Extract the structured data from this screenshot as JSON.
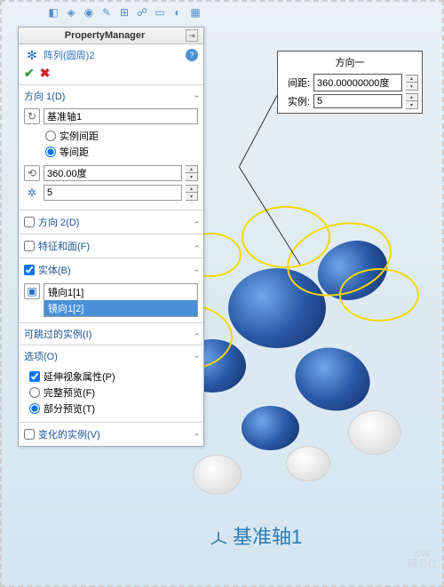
{
  "panel": {
    "title": "PropertyManager",
    "feature_name": "阵列(圆周)2",
    "sections": {
      "direction1": {
        "title": "方向 1(D)",
        "axis_value": "基准轴1",
        "radio_instance": "实例间距",
        "radio_equal": "等间距",
        "angle_value": "360.00度",
        "count_value": "5"
      },
      "direction2": {
        "title": "方向 2(D)"
      },
      "features_faces": {
        "title": "特征和面(F)"
      },
      "bodies": {
        "title": "实体(B)",
        "items": [
          "镜向1[1]",
          "镜向1[2]"
        ]
      },
      "skip_instances": {
        "title": "可跳过的实例(I)"
      },
      "options": {
        "title": "选项(O)",
        "extend_visual": "延伸视象属性(P)",
        "full_preview": "完整预览(F)",
        "partial_preview": "部分预览(T)"
      },
      "varied_instances": {
        "title": "变化的实例(V)"
      }
    }
  },
  "callout": {
    "title": "方向一",
    "spacing_label": "间距:",
    "spacing_value": "360.00000000度",
    "instances_label": "实例:",
    "instances_value": "5"
  },
  "viewport": {
    "axis_label": "基准轴1"
  },
  "watermark": {
    "l1": "SW",
    "l2": "研习社"
  }
}
